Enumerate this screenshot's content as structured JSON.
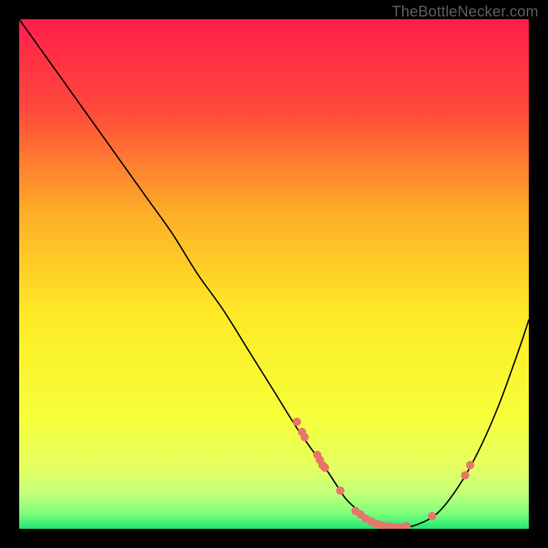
{
  "watermark": "TheBottleNecker.com",
  "chart_data": {
    "type": "line",
    "title": "",
    "xlabel": "",
    "ylabel": "",
    "xlim": [
      0,
      100
    ],
    "ylim": [
      0,
      100
    ],
    "grid": false,
    "gradient_stops": [
      {
        "offset": 0.0,
        "color": "#ff1e4c"
      },
      {
        "offset": 0.18,
        "color": "#ff4a3a"
      },
      {
        "offset": 0.38,
        "color": "#feae28"
      },
      {
        "offset": 0.58,
        "color": "#feea26"
      },
      {
        "offset": 0.78,
        "color": "#f6ff3a"
      },
      {
        "offset": 0.88,
        "color": "#e4ff60"
      },
      {
        "offset": 0.93,
        "color": "#c4ff7a"
      },
      {
        "offset": 0.97,
        "color": "#7dff7a"
      },
      {
        "offset": 1.0,
        "color": "#20e574"
      }
    ],
    "series": [
      {
        "name": "bottleneck-curve",
        "color": "#000000",
        "width": 2,
        "x": [
          0,
          5,
          10,
          15,
          20,
          25,
          30,
          35,
          40,
          45,
          50,
          55,
          60,
          62,
          64,
          66,
          68,
          70,
          72,
          75,
          78,
          82,
          86,
          90,
          94,
          98,
          100
        ],
        "y": [
          100,
          93,
          86,
          79,
          72,
          65,
          58,
          50,
          43,
          35,
          27,
          19,
          12,
          9,
          6,
          4,
          2,
          1,
          0.5,
          0.3,
          0.8,
          3,
          8,
          15,
          24,
          35,
          41
        ]
      }
    ],
    "markers": {
      "color": "#e8756a",
      "radius": 6,
      "points": [
        {
          "x": 54.5,
          "y": 21.0
        },
        {
          "x": 55.5,
          "y": 19.0
        },
        {
          "x": 56.0,
          "y": 18.0
        },
        {
          "x": 58.5,
          "y": 14.5
        },
        {
          "x": 59.0,
          "y": 13.5
        },
        {
          "x": 59.5,
          "y": 12.5
        },
        {
          "x": 60.0,
          "y": 12.0
        },
        {
          "x": 63.0,
          "y": 7.5
        },
        {
          "x": 66.0,
          "y": 3.5
        },
        {
          "x": 67.0,
          "y": 2.8
        },
        {
          "x": 68.0,
          "y": 2.0
        },
        {
          "x": 69.0,
          "y": 1.5
        },
        {
          "x": 70.0,
          "y": 1.0
        },
        {
          "x": 71.0,
          "y": 0.7
        },
        {
          "x": 72.0,
          "y": 0.5
        },
        {
          "x": 73.0,
          "y": 0.4
        },
        {
          "x": 74.0,
          "y": 0.3
        },
        {
          "x": 75.0,
          "y": 0.3
        },
        {
          "x": 76.0,
          "y": 0.5
        },
        {
          "x": 81.0,
          "y": 2.5
        },
        {
          "x": 87.5,
          "y": 10.5
        },
        {
          "x": 88.5,
          "y": 12.5
        }
      ]
    }
  }
}
